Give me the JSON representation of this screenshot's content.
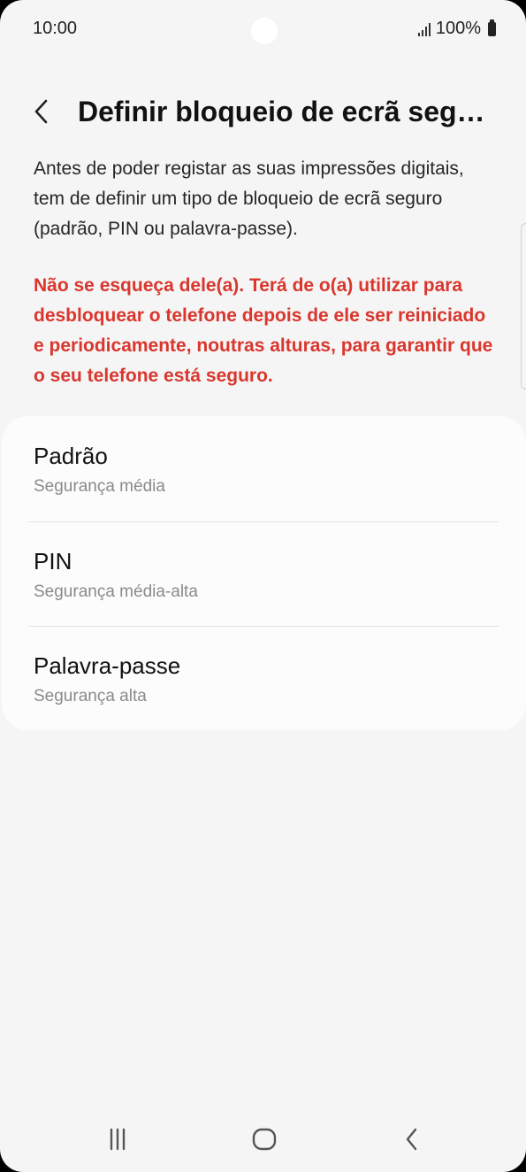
{
  "status_bar": {
    "time": "10:00",
    "battery": "100%",
    "icons": [
      "signal-icon",
      "battery-icon"
    ]
  },
  "header": {
    "back_icon": "chevron-left-icon",
    "title": "Definir bloqueio de ecrã seguro"
  },
  "intro_text": "Antes de poder registar as suas impressões digitais, tem de definir um tipo de bloqueio de ecrã seguro (padrão, PIN ou palavra-passe).",
  "warning_text": "Não se esqueça dele(a). Terá de o(a) utilizar para desbloquear o telefone depois de ele ser reiniciado e periodicamente, noutras alturas, para garantir que o seu telefone está seguro.",
  "colors": {
    "warning": "#d9362d",
    "background": "#f5f5f5",
    "card": "#fcfcfc",
    "subtitle": "#8a8a8a"
  },
  "options": [
    {
      "title": "Padrão",
      "subtitle": "Segurança média"
    },
    {
      "title": "PIN",
      "subtitle": "Segurança média-alta"
    },
    {
      "title": "Palavra-passe",
      "subtitle": "Segurança alta"
    }
  ],
  "nav_bar": {
    "icons": [
      "recent-apps-icon",
      "home-icon",
      "back-icon"
    ]
  }
}
